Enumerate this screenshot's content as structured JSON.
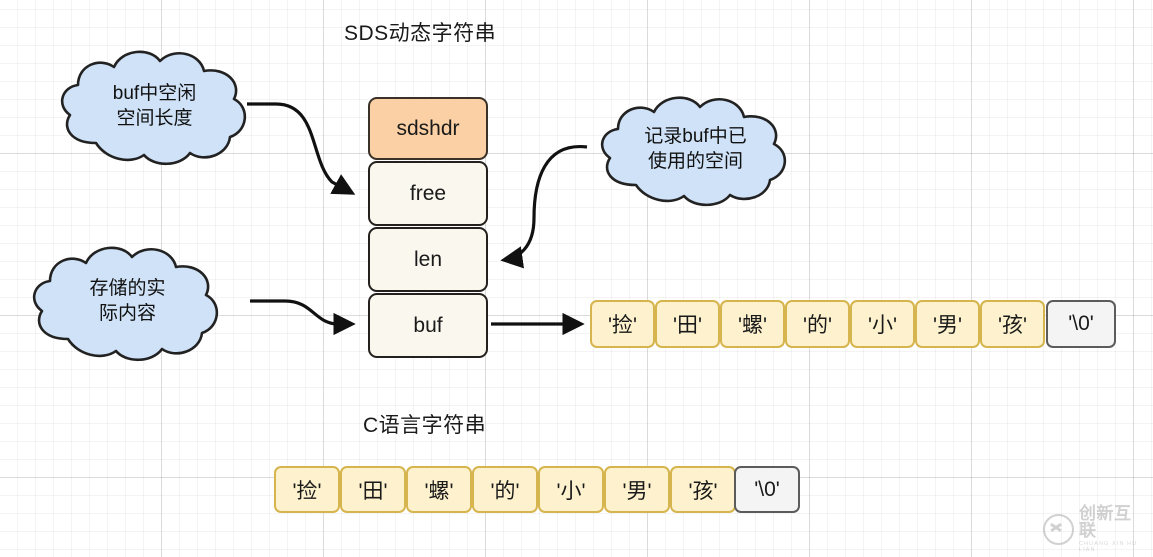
{
  "diagram": {
    "titles": {
      "sds": "SDS动态字符串",
      "c": "C语言字符串"
    },
    "struct_blocks": [
      {
        "label": "sdshdr",
        "fill": "#fad0a4"
      },
      {
        "label": "free",
        "fill": "#faf7ee"
      },
      {
        "label": "len",
        "fill": "#faf7ee"
      },
      {
        "label": "buf",
        "fill": "#faf7ee"
      }
    ],
    "clouds": [
      {
        "id": "free-note",
        "lines": [
          "buf中空闲",
          "空间长度"
        ],
        "fill": "#cfe2f7"
      },
      {
        "id": "buf-note",
        "lines": [
          "存储的实",
          "际内容"
        ],
        "fill": "#cfe2f7"
      },
      {
        "id": "len-note",
        "lines": [
          "记录buf中已",
          "使用的空间"
        ],
        "fill": "#cfe2f7"
      }
    ],
    "sds_char_array": [
      {
        "value": "'捡'",
        "terminator": false
      },
      {
        "value": "'田'",
        "terminator": false
      },
      {
        "value": "'螺'",
        "terminator": false
      },
      {
        "value": "'的'",
        "terminator": false
      },
      {
        "value": "'小'",
        "terminator": false
      },
      {
        "value": "'男'",
        "terminator": false
      },
      {
        "value": "'孩'",
        "terminator": false
      },
      {
        "value": "'\\0'",
        "terminator": true
      }
    ],
    "c_char_array": [
      {
        "value": "'捡'",
        "terminator": false
      },
      {
        "value": "'田'",
        "terminator": false
      },
      {
        "value": "'螺'",
        "terminator": false
      },
      {
        "value": "'的'",
        "terminator": false
      },
      {
        "value": "'小'",
        "terminator": false
      },
      {
        "value": "'男'",
        "terminator": false
      },
      {
        "value": "'孩'",
        "terminator": false
      },
      {
        "value": "'\\0'",
        "terminator": true
      }
    ],
    "colors": {
      "header_fill": "#fad0a4",
      "field_fill": "#faf7ee",
      "cell_fill": "#fdf2cd",
      "cell_border": "#d6b44e",
      "null_fill": "#f4f4f4",
      "null_border": "#5c5c5c",
      "cloud_fill": "#cfe2f7",
      "cloud_border": "#222222",
      "stroke": "#23201d"
    }
  },
  "watermark": {
    "name": "创新互联",
    "sub": "CHUANG XIN HU LIAN"
  }
}
